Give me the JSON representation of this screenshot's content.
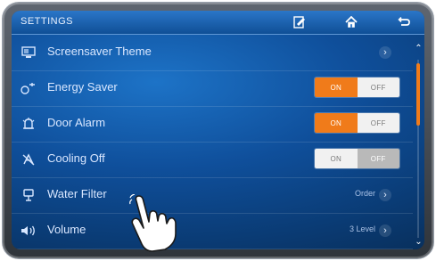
{
  "titlebar": {
    "title": "SETTINGS",
    "icons": [
      "edit-icon",
      "home-icon",
      "back-icon"
    ]
  },
  "rows": [
    {
      "label": "Screensaver Theme",
      "icon": "screen-icon",
      "control": "chevron"
    },
    {
      "label": "Energy Saver",
      "icon": "energy-icon",
      "control": "toggle",
      "on_label": "ON",
      "off_label": "OFF",
      "state": "on"
    },
    {
      "label": "Door Alarm",
      "icon": "door-alarm-icon",
      "control": "toggle",
      "on_label": "ON",
      "off_label": "OFF",
      "state": "on"
    },
    {
      "label": "Cooling Off",
      "icon": "cooling-off-icon",
      "control": "toggle",
      "on_label": "ON",
      "off_label": "OFF",
      "state": "off"
    },
    {
      "label": "Water Filter",
      "icon": "water-filter-icon",
      "control": "chevron",
      "status": "Order"
    },
    {
      "label": "Volume",
      "icon": "volume-icon",
      "control": "chevron",
      "status": "3 Level"
    }
  ],
  "colors": {
    "accent": "#f07b1a",
    "screen_bg": "#0f4f9b",
    "titlebar_bg": "#2b76c8"
  },
  "scrollbar": {
    "position_fraction": 0.0
  }
}
